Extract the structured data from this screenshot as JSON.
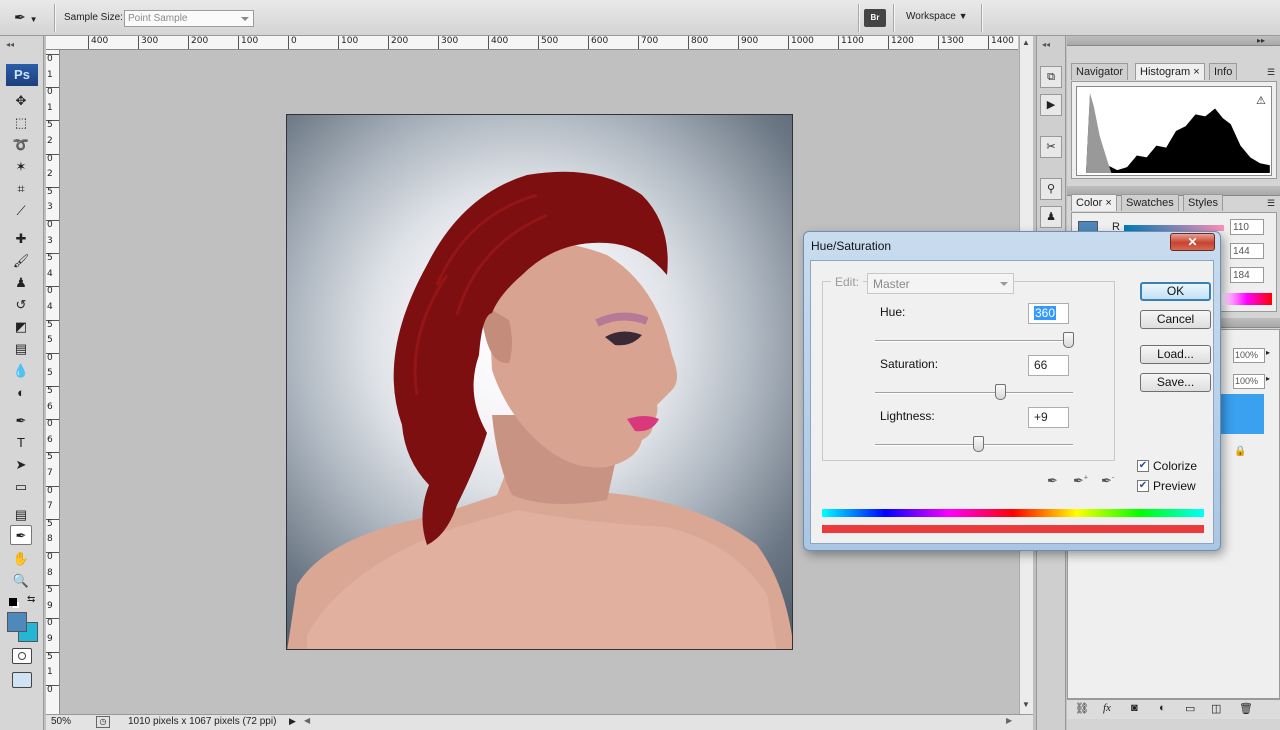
{
  "options_bar": {
    "sample_size_label": "Sample Size:",
    "sample_size_value": "Point Sample",
    "workspace_label": "Workspace"
  },
  "toolbox": {
    "logo": "Ps"
  },
  "ruler": {
    "h_labels": [
      "400",
      "300",
      "200",
      "100",
      "0",
      "100",
      "200",
      "300",
      "400",
      "500",
      "600",
      "700",
      "800",
      "900",
      "1000",
      "1100",
      "1200",
      "1300",
      "1400"
    ],
    "v_labels": [
      "0",
      "1",
      "0",
      "1",
      "5",
      "2",
      "0",
      "2",
      "5",
      "3",
      "0",
      "3",
      "5",
      "4",
      "0",
      "4",
      "5",
      "5",
      "0",
      "5",
      "5",
      "6",
      "0",
      "6",
      "5",
      "7",
      "0",
      "7",
      "5",
      "8",
      "0",
      "8",
      "5",
      "9",
      "0",
      "9",
      "5",
      "1",
      "0"
    ]
  },
  "status": {
    "zoom": "50%",
    "doc_info": "1010 pixels x 1067 pixels (72 ppi)"
  },
  "panels": {
    "top_tabs": [
      "Navigator",
      "Histogram",
      "Info"
    ],
    "active_top_tab": "Histogram",
    "color_tabs": [
      "Color",
      "Swatches",
      "Styles"
    ],
    "color_channel_label": "R",
    "color_values": [
      "110",
      "144",
      "184"
    ],
    "layer_percents": [
      "100%",
      "100%"
    ]
  },
  "dialog": {
    "title": "Hue/Saturation",
    "edit_label": "Edit:",
    "edit_value": "Master",
    "hue_label": "Hue:",
    "hue_value": "360",
    "saturation_label": "Saturation:",
    "saturation_value": "66",
    "lightness_label": "Lightness:",
    "lightness_value": "+9",
    "ok_label": "OK",
    "cancel_label": "Cancel",
    "load_label": "Load...",
    "save_label": "Save...",
    "colorize_label": "Colorize",
    "preview_label": "Preview",
    "colorize_checked": true,
    "preview_checked": true
  },
  "colors": {
    "foreground": "#4f88bb",
    "background": "#23b6d6",
    "hair": "#7d0f10",
    "selection": "#3aa0f0"
  }
}
